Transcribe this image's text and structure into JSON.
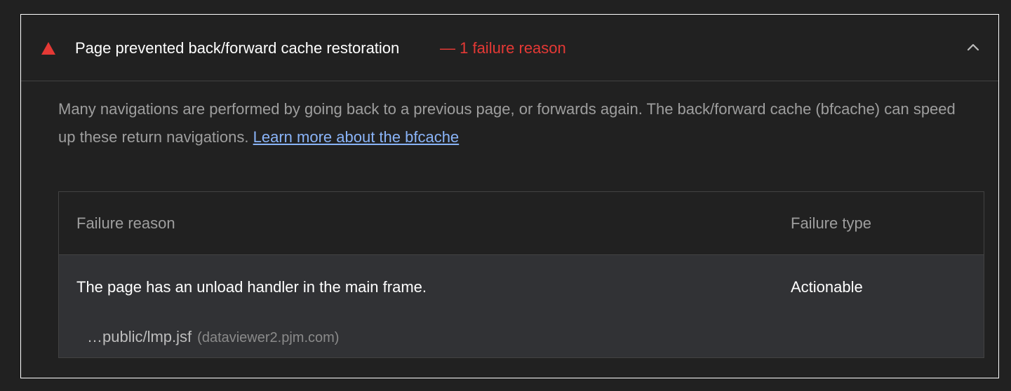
{
  "audit": {
    "title": "Page prevented back/forward cache restoration",
    "display_value": "— 1 failure reason",
    "status_icon": "fail-triangle-icon",
    "status_color": "#e53935",
    "expanded": true,
    "description_text": "Many navigations are performed by going back to a previous page, or forwards again. The back/forward cache (bfcache) can speed up these return navigations.",
    "learn_more_label": "Learn more about the bfcache",
    "link_color": "#8ab4f8"
  },
  "table": {
    "headers": {
      "reason": "Failure reason",
      "type": "Failure type"
    },
    "rows": [
      {
        "reason": "The page has an unload handler in the main frame.",
        "type": "Actionable",
        "subitem": {
          "path": "…public/lmp.jsf",
          "host": "(dataviewer2.pjm.com)"
        }
      }
    ]
  }
}
